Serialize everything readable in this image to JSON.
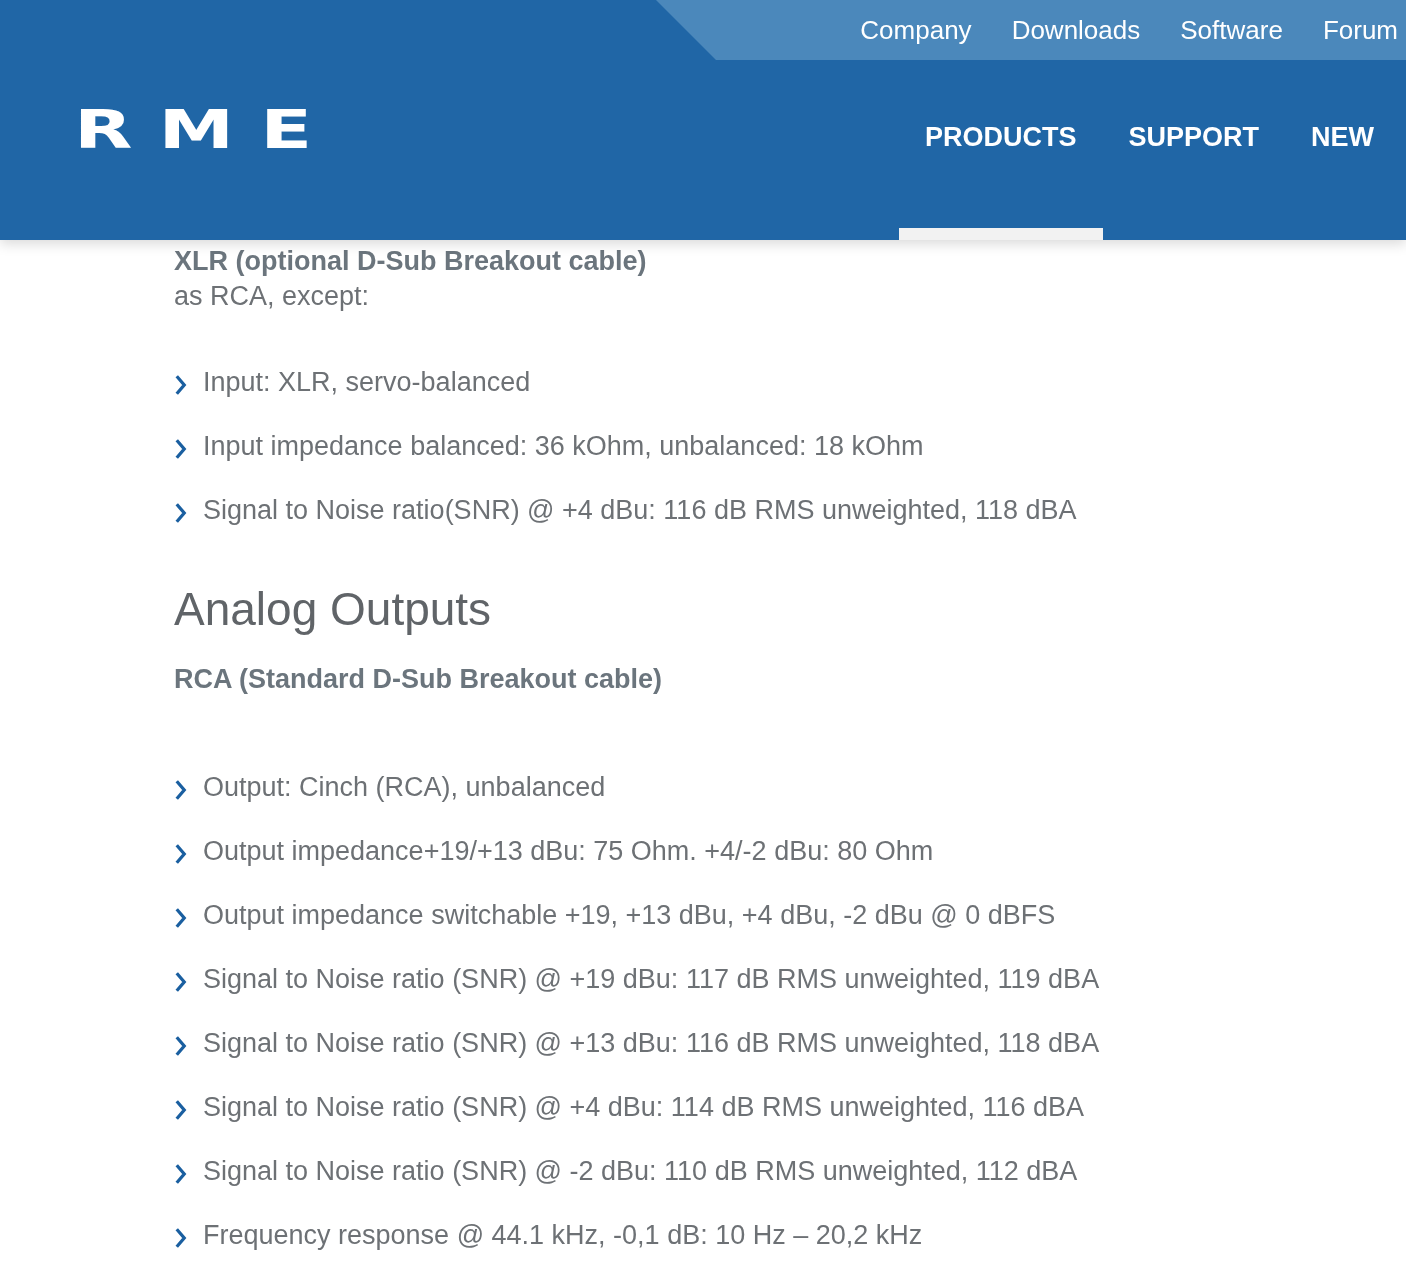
{
  "header": {
    "logo": "RME",
    "top_links": [
      "Company",
      "Downloads",
      "Software",
      "Forum"
    ],
    "nav": [
      {
        "label": "PRODUCTS",
        "selected": true
      },
      {
        "label": "SUPPORT",
        "selected": false
      },
      {
        "label": "NEW",
        "selected": false
      }
    ]
  },
  "content": [
    {
      "kind": "subheading",
      "text": "XLR (optional D-Sub Breakout cable)"
    },
    {
      "kind": "text",
      "text": "as RCA, except:"
    },
    {
      "kind": "list",
      "items": [
        "Input: XLR, servo-balanced",
        "Input impedance balanced: 36 kOhm, unbalanced: 18 kOhm",
        "Signal to Noise ratio(SNR) @ +4 dBu: 116 dB RMS unweighted, 118 dBA"
      ]
    },
    {
      "kind": "heading",
      "text": "Analog Outputs"
    },
    {
      "kind": "subheading",
      "text": "RCA (Standard D-Sub Breakout cable)"
    },
    {
      "kind": "list",
      "items": [
        "Output: Cinch (RCA), unbalanced",
        "Output impedance+19/+13 dBu: 75 Ohm. +4/-2 dBu: 80 Ohm",
        "Output impedance switchable +19, +13 dBu, +4 dBu, -2 dBu @ 0 dBFS",
        "Signal to Noise ratio (SNR) @ +19 dBu: 117 dB RMS unweighted, 119 dBA",
        "Signal to Noise ratio (SNR) @ +13 dBu: 116 dB RMS unweighted, 118 dBA",
        "Signal to Noise ratio (SNR) @ +4 dBu: 114 dB RMS unweighted, 116 dBA",
        "Signal to Noise ratio (SNR) @ -2 dBu: 110 dB RMS unweighted, 112 dBA",
        "Frequency response @ 44.1 kHz, -0,1 dB: 10 Hz – 20,2 kHz"
      ]
    }
  ]
}
